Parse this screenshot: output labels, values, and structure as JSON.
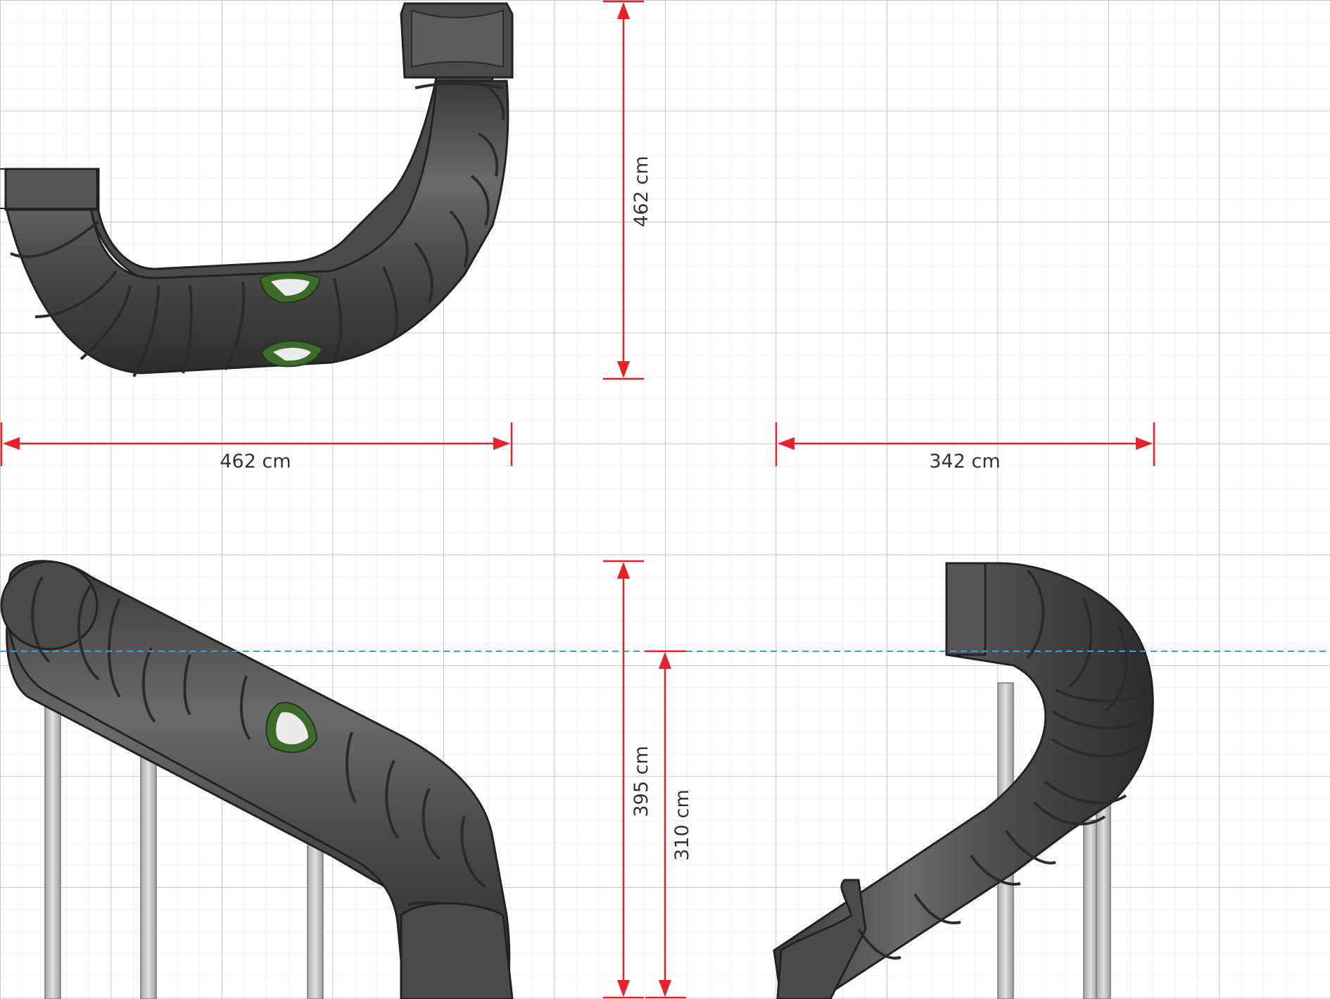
{
  "dimensions": {
    "top_width": "462 cm",
    "top_height": "462 cm",
    "side_right_width": "342 cm",
    "total_height": "395 cm",
    "slide_height": "310 cm"
  },
  "colors": {
    "dimension_line": "#e8212b",
    "reference_line": "#2aa8d8",
    "tube": "#4a4a4a",
    "tube_ring": "#2b2b2b",
    "window_frame": "#3d6b2c",
    "grid_major": "#b5b5b5",
    "grid_minor": "#e6e6e6",
    "post": "#c9c9c9"
  }
}
